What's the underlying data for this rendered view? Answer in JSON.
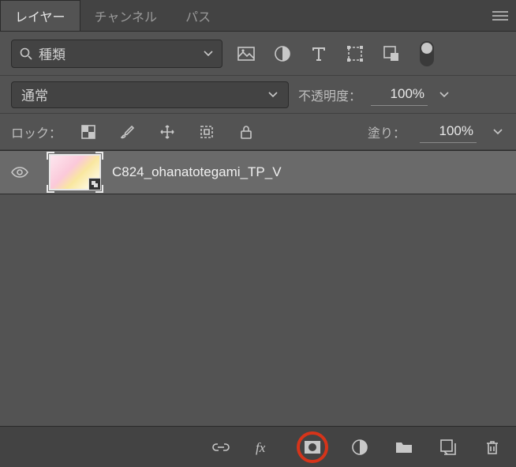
{
  "tabs": {
    "layers": "レイヤー",
    "channels": "チャンネル",
    "paths": "パス"
  },
  "filter": {
    "type_label": "種類"
  },
  "blend": {
    "mode": "通常",
    "opacity_label": "不透明度：",
    "opacity_value": "100%"
  },
  "lock": {
    "label": "ロック：",
    "fill_label": "塗り：",
    "fill_value": "100%"
  },
  "layers": [
    {
      "name": "C824_ohanatotegami_TP_V",
      "visible": true,
      "smart_object": true
    }
  ]
}
